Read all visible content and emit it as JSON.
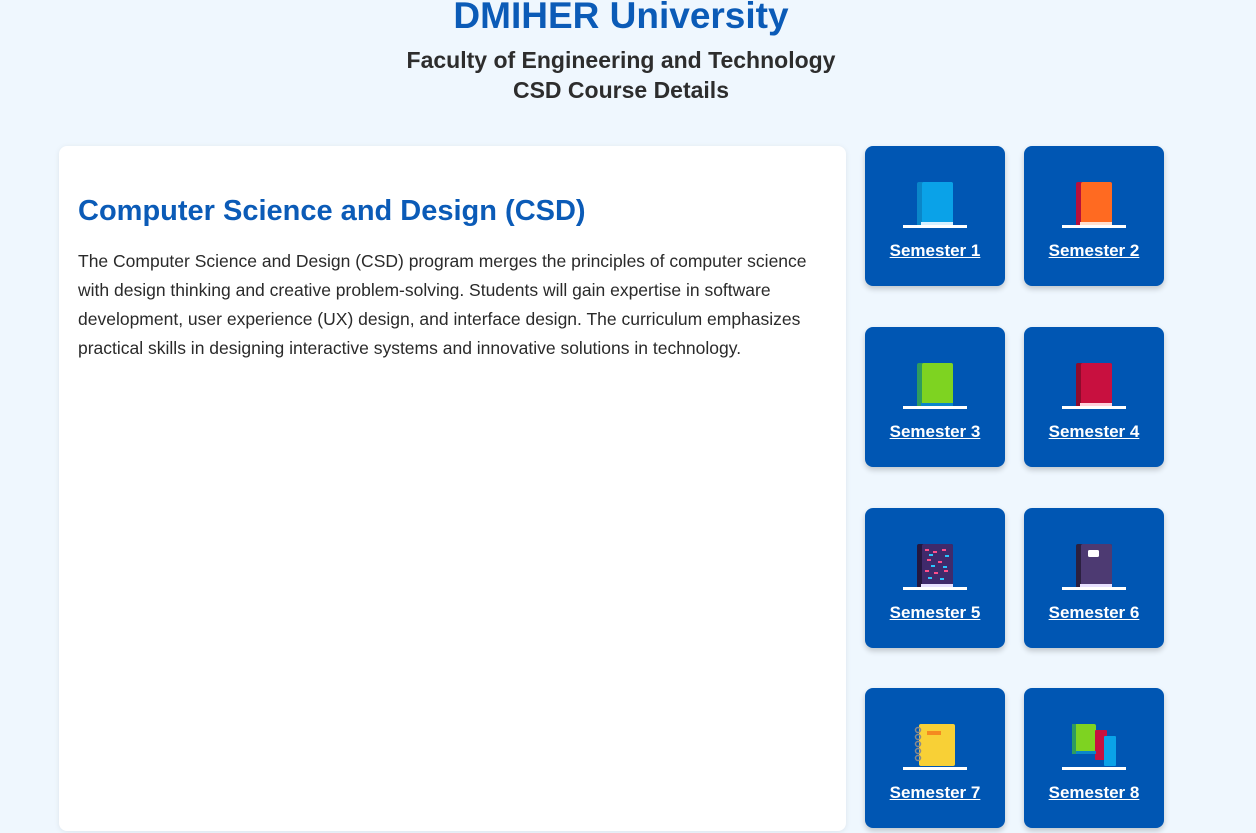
{
  "header": {
    "university": "DMIHER University",
    "faculty": "Faculty of Engineering and Technology",
    "course": "CSD Course Details"
  },
  "program": {
    "title": "Computer Science and Design (CSD)",
    "description": "The Computer Science and Design (CSD) program merges the principles of computer science with design thinking and creative problem-solving. Students will gain expertise in software development, user experience (UX) design, and interface design. The curriculum emphasizes practical skills in designing interactive systems and innovative solutions in technology."
  },
  "semesters": [
    {
      "label": "Semester 1",
      "icon": "blue-book-icon",
      "color": "#0aa2e8"
    },
    {
      "label": "Semester 2",
      "icon": "orange-book-icon",
      "color": "#ff6a21"
    },
    {
      "label": "Semester 3",
      "icon": "green-book-icon",
      "color": "#7ed321"
    },
    {
      "label": "Semester 4",
      "icon": "red-book-icon",
      "color": "#c8103f"
    },
    {
      "label": "Semester 5",
      "icon": "patterned-notebook-icon",
      "color": "#3f2a6b"
    },
    {
      "label": "Semester 6",
      "icon": "purple-notebook-icon",
      "color": "#4d3a72"
    },
    {
      "label": "Semester 7",
      "icon": "spiral-notebook-icon",
      "color": "#f8d036"
    },
    {
      "label": "Semester 8",
      "icon": "stacked-books-icon",
      "color": "#7ed321"
    }
  ]
}
